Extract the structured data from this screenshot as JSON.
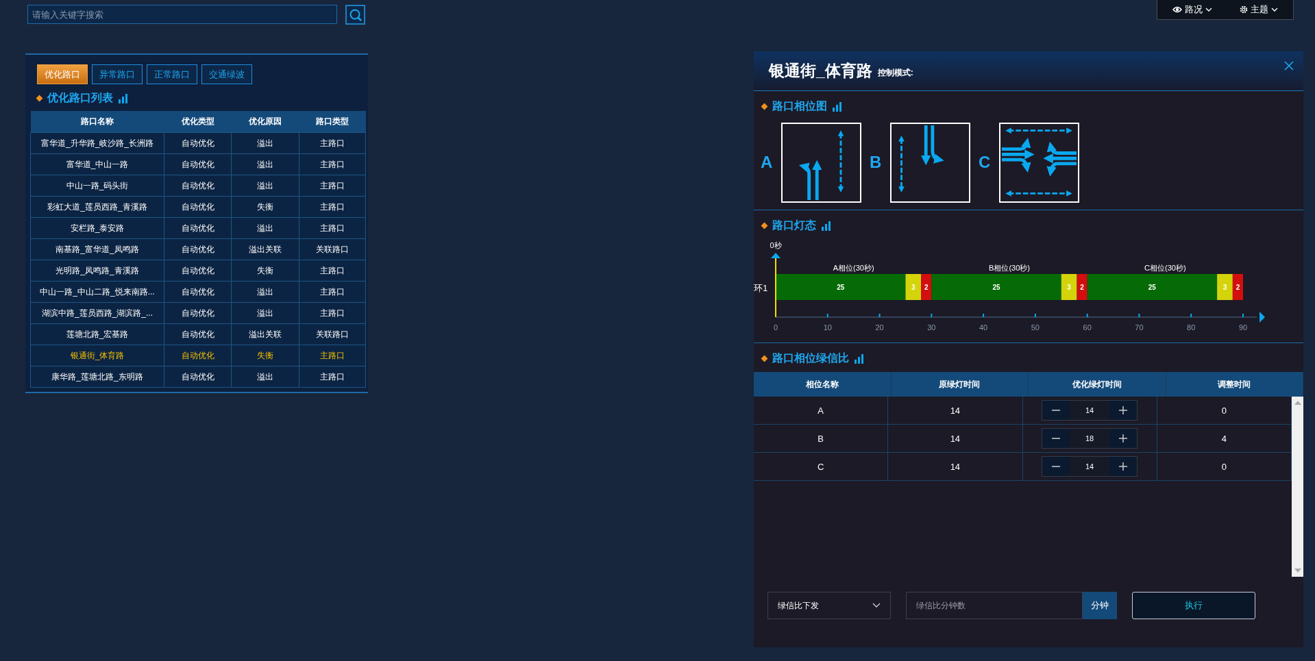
{
  "search": {
    "placeholder": "请输入关键字搜索"
  },
  "top_menu": [
    {
      "label": "路况",
      "kind": "view"
    },
    {
      "label": "主题",
      "kind": "settings"
    }
  ],
  "left_panel": {
    "tabs": [
      {
        "label": "优化路口",
        "selected": true
      },
      {
        "label": "异常路口",
        "selected": false
      },
      {
        "label": "正常路口",
        "selected": false
      },
      {
        "label": "交通绿波",
        "selected": false
      }
    ],
    "title": "优化路口列表",
    "table": {
      "columns": [
        "路口名称",
        "优化类型",
        "优化原因",
        "路口类型"
      ],
      "rows": [
        {
          "cells": [
            "富华道_升华路_岐沙路_长洲路",
            "自动优化",
            "溢出",
            "主路口"
          ],
          "selected": false
        },
        {
          "cells": [
            "富华道_中山一路",
            "自动优化",
            "溢出",
            "主路口"
          ],
          "selected": false
        },
        {
          "cells": [
            "中山一路_码头街",
            "自动优化",
            "溢出",
            "主路口"
          ],
          "selected": false
        },
        {
          "cells": [
            "彩虹大道_莲员西路_青溪路",
            "自动优化",
            "失衡",
            "主路口"
          ],
          "selected": false
        },
        {
          "cells": [
            "安栏路_泰安路",
            "自动优化",
            "溢出",
            "主路口"
          ],
          "selected": false
        },
        {
          "cells": [
            "南基路_富华道_凤鸣路",
            "自动优化",
            "溢出关联",
            "关联路口"
          ],
          "selected": false
        },
        {
          "cells": [
            "光明路_凤鸣路_青溪路",
            "自动优化",
            "失衡",
            "主路口"
          ],
          "selected": false
        },
        {
          "cells": [
            "中山一路_中山二路_悦来南路...",
            "自动优化",
            "溢出",
            "主路口"
          ],
          "selected": false
        },
        {
          "cells": [
            "湖滨中路_莲员西路_湖滨路_...",
            "自动优化",
            "溢出",
            "主路口"
          ],
          "selected": false
        },
        {
          "cells": [
            "莲塘北路_宏基路",
            "自动优化",
            "溢出关联",
            "关联路口"
          ],
          "selected": false
        },
        {
          "cells": [
            "银通街_体育路",
            "自动优化",
            "失衡",
            "主路口"
          ],
          "selected": true
        },
        {
          "cells": [
            "康华路_莲塘北路_东明路",
            "自动优化",
            "溢出",
            "主路口"
          ],
          "selected": false
        }
      ]
    }
  },
  "detail": {
    "title": "银通街_体育路",
    "mode_label": "控制模式:",
    "phase_diagram": {
      "title": "路口相位图",
      "phases": [
        {
          "label": "A",
          "kind": "northbound"
        },
        {
          "label": "B",
          "kind": "southbound"
        },
        {
          "label": "C",
          "kind": "eastwest"
        }
      ]
    },
    "signal_timing": {
      "title": "路口灯态",
      "chart_data": {
        "type": "bar",
        "orientation": "horizontal",
        "stacked": true,
        "categories": [
          "环1"
        ],
        "series": [
          {
            "color": "#066b06",
            "values": [
              25
            ]
          },
          {
            "color": "#d4d40a",
            "values": [
              3
            ]
          },
          {
            "color": "#d40e0e",
            "values": [
              2
            ]
          },
          {
            "color": "#066b06",
            "values": [
              25
            ]
          },
          {
            "color": "#d4d40a",
            "values": [
              3
            ]
          },
          {
            "color": "#d40e0e",
            "values": [
              2
            ]
          },
          {
            "color": "#066b06",
            "values": [
              25
            ]
          },
          {
            "color": "#d4d40a",
            "values": [
              3
            ]
          },
          {
            "color": "#d40e0e",
            "values": [
              2
            ]
          }
        ],
        "xlim": [
          0,
          90
        ],
        "xticks": [
          0,
          10,
          20,
          30,
          40,
          50,
          60,
          70,
          80,
          90
        ],
        "data_labels": true,
        "annotations": [
          "0秒",
          "A相位(30秒)",
          "B相位(30秒)",
          "C相位(30秒)"
        ]
      }
    },
    "green_ratio": {
      "title": "路口相位绿信比",
      "columns": [
        "相位名称",
        "原绿灯时间",
        "优化绿灯时间",
        "调整时间"
      ],
      "rows": [
        {
          "phase": "A",
          "original": "14",
          "optimized": "14",
          "adjustment": "0"
        },
        {
          "phase": "B",
          "original": "14",
          "optimized": "18",
          "adjustment": "4"
        },
        {
          "phase": "C",
          "original": "14",
          "optimized": "14",
          "adjustment": "0"
        }
      ]
    },
    "footer": {
      "dropdown": {
        "value": "绿信比下发"
      },
      "minutes_field": {
        "placeholder": "绿信比分钟数"
      },
      "unit_button": "分钟",
      "execute_button": "执行"
    }
  }
}
